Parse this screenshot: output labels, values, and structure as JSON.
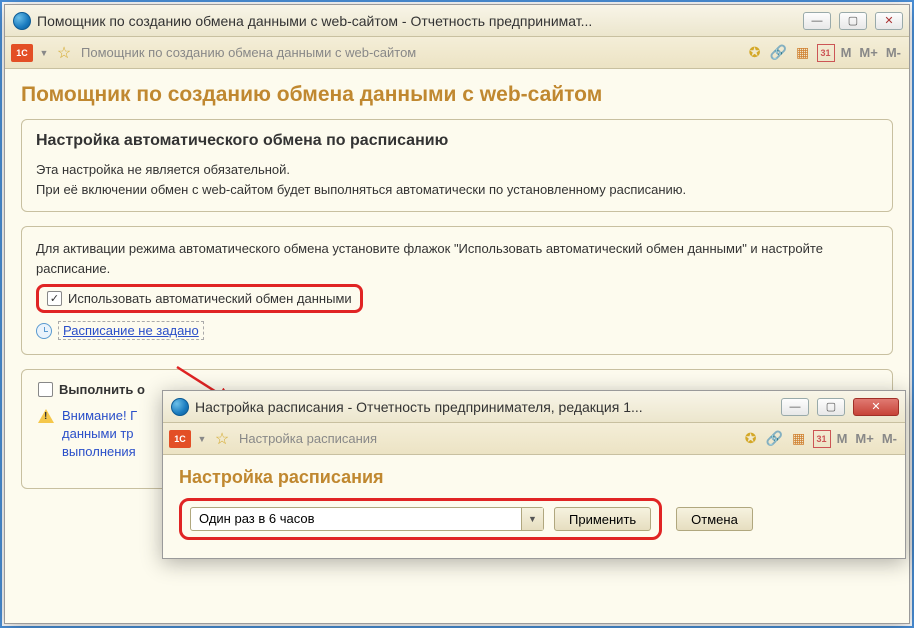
{
  "main": {
    "titlebar": "Помощник по созданию обмена данными с web-сайтом - Отчетность предпринимат...",
    "toolbar_title": "Помощник по созданию обмена данными с web-сайтом",
    "logo": "1C",
    "m_buttons": [
      "M",
      "M+",
      "M-"
    ],
    "page_title": "Помощник по созданию обмена данными с web-сайтом",
    "panel1": {
      "heading": "Настройка автоматического обмена по расписанию",
      "line1": "Эта настройка не является обязательной.",
      "line2": "При её включении обмен с web-сайтом будет выполняться автоматически по установленному расписанию."
    },
    "panel2": {
      "intro": "Для активации режима автоматического обмена установите флажок \"Использовать автоматический обмен данными\" и настройте расписание.",
      "checkbox_label": "Использовать автоматический обмен данными",
      "schedule_link": "Расписание не задано"
    },
    "panel3": {
      "exec_label": "Выполнить о",
      "warn_line1": "Внимание! Г",
      "warn_line2": "данными тр",
      "warn_line3": "выполнения"
    }
  },
  "modal": {
    "titlebar": "Настройка расписания - Отчетность предпринимателя, редакция 1...",
    "toolbar_title": "Настройка расписания",
    "page_title": "Настройка расписания",
    "dropdown_value": "Один раз в 6 часов",
    "apply": "Применить",
    "cancel": "Отмена"
  },
  "icons": {
    "star_add": "star",
    "link": "link",
    "calc": "calc",
    "calendar": "31"
  }
}
